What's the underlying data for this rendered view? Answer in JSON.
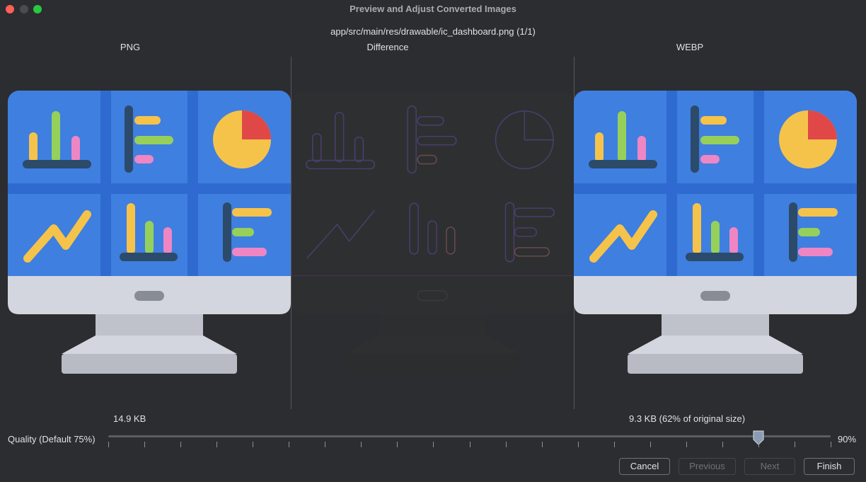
{
  "window": {
    "title": "Preview and Adjust Converted Images"
  },
  "file": {
    "path": "app/src/main/res/drawable/ic_dashboard.png (1/1)"
  },
  "columns": {
    "left": "PNG",
    "middle": "Difference",
    "right": "WEBP"
  },
  "sizes": {
    "original": "14.9 KB",
    "converted": "9.3 KB (62% of original size)"
  },
  "quality": {
    "label": "Quality (Default 75%)",
    "value_text": "90%",
    "value": 90,
    "min": 0,
    "max": 100,
    "ticks": 21
  },
  "buttons": {
    "cancel": "Cancel",
    "previous": "Previous",
    "next": "Next",
    "finish": "Finish"
  },
  "colors": {
    "background": "#2b2d30",
    "screen_blue": "#3f7fe0",
    "grid_blue": "#2f6ad0",
    "monitor_grey": "#d3d6de",
    "stand_grey": "#c4c7cf",
    "chart_yellow": "#f6c34a",
    "chart_green": "#96d05a",
    "chart_pink": "#ef86c4",
    "chart_navy": "#2c4a6a",
    "chart_red": "#e04848"
  }
}
